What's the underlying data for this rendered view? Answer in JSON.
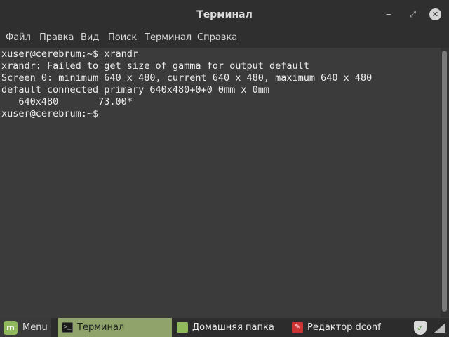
{
  "window": {
    "title": "Терминал",
    "controls": {
      "minimize": "‒",
      "maximize": "⤢",
      "close": "✕"
    }
  },
  "menubar": {
    "items": [
      "Файл",
      "Правка",
      "Вид",
      "Поиск",
      "Терминал",
      "Справка"
    ]
  },
  "terminal": {
    "lines": [
      "xuser@cerebrum:~$ xrandr",
      "xrandr: Failed to get size of gamma for output default",
      "Screen 0: minimum 640 x 480, current 640 x 480, maximum 640 x 480",
      "default connected primary 640x480+0+0 0mm x 0mm",
      "   640x480       73.00*",
      "xuser@cerebrum:~$ "
    ]
  },
  "taskbar": {
    "menu_label": "Menu",
    "tasks": [
      {
        "label": "Терминал",
        "icon": "terminal-icon",
        "active": true
      },
      {
        "label": "Домашняя папка",
        "icon": "folder-icon",
        "active": false
      },
      {
        "label": "Редактор dconf",
        "icon": "dconf-icon",
        "active": false
      }
    ],
    "tray": [
      "shield-check-icon",
      "network-icon"
    ]
  },
  "colors": {
    "accent": "#8fa36a",
    "mint_green": "#8fb95a",
    "terminal_bg": "#3b3b3b",
    "text": "#ececec"
  }
}
